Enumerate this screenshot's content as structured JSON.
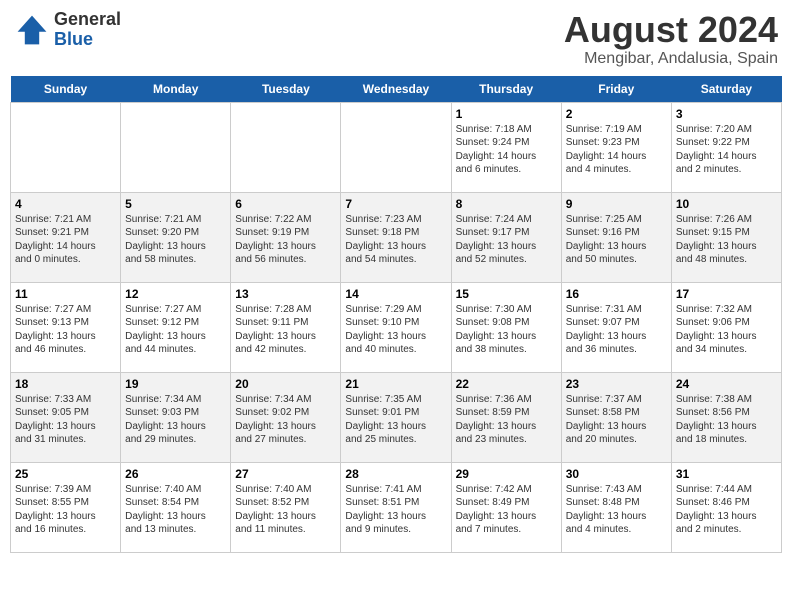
{
  "header": {
    "logo_line1": "General",
    "logo_line2": "Blue",
    "title": "August 2024",
    "subtitle": "Mengibar, Andalusia, Spain"
  },
  "columns": [
    "Sunday",
    "Monday",
    "Tuesday",
    "Wednesday",
    "Thursday",
    "Friday",
    "Saturday"
  ],
  "weeks": [
    {
      "days": [
        {
          "num": "",
          "info": ""
        },
        {
          "num": "",
          "info": ""
        },
        {
          "num": "",
          "info": ""
        },
        {
          "num": "",
          "info": ""
        },
        {
          "num": "1",
          "info": "Sunrise: 7:18 AM\nSunset: 9:24 PM\nDaylight: 14 hours\nand 6 minutes."
        },
        {
          "num": "2",
          "info": "Sunrise: 7:19 AM\nSunset: 9:23 PM\nDaylight: 14 hours\nand 4 minutes."
        },
        {
          "num": "3",
          "info": "Sunrise: 7:20 AM\nSunset: 9:22 PM\nDaylight: 14 hours\nand 2 minutes."
        }
      ]
    },
    {
      "days": [
        {
          "num": "4",
          "info": "Sunrise: 7:21 AM\nSunset: 9:21 PM\nDaylight: 14 hours\nand 0 minutes."
        },
        {
          "num": "5",
          "info": "Sunrise: 7:21 AM\nSunset: 9:20 PM\nDaylight: 13 hours\nand 58 minutes."
        },
        {
          "num": "6",
          "info": "Sunrise: 7:22 AM\nSunset: 9:19 PM\nDaylight: 13 hours\nand 56 minutes."
        },
        {
          "num": "7",
          "info": "Sunrise: 7:23 AM\nSunset: 9:18 PM\nDaylight: 13 hours\nand 54 minutes."
        },
        {
          "num": "8",
          "info": "Sunrise: 7:24 AM\nSunset: 9:17 PM\nDaylight: 13 hours\nand 52 minutes."
        },
        {
          "num": "9",
          "info": "Sunrise: 7:25 AM\nSunset: 9:16 PM\nDaylight: 13 hours\nand 50 minutes."
        },
        {
          "num": "10",
          "info": "Sunrise: 7:26 AM\nSunset: 9:15 PM\nDaylight: 13 hours\nand 48 minutes."
        }
      ]
    },
    {
      "days": [
        {
          "num": "11",
          "info": "Sunrise: 7:27 AM\nSunset: 9:13 PM\nDaylight: 13 hours\nand 46 minutes."
        },
        {
          "num": "12",
          "info": "Sunrise: 7:27 AM\nSunset: 9:12 PM\nDaylight: 13 hours\nand 44 minutes."
        },
        {
          "num": "13",
          "info": "Sunrise: 7:28 AM\nSunset: 9:11 PM\nDaylight: 13 hours\nand 42 minutes."
        },
        {
          "num": "14",
          "info": "Sunrise: 7:29 AM\nSunset: 9:10 PM\nDaylight: 13 hours\nand 40 minutes."
        },
        {
          "num": "15",
          "info": "Sunrise: 7:30 AM\nSunset: 9:08 PM\nDaylight: 13 hours\nand 38 minutes."
        },
        {
          "num": "16",
          "info": "Sunrise: 7:31 AM\nSunset: 9:07 PM\nDaylight: 13 hours\nand 36 minutes."
        },
        {
          "num": "17",
          "info": "Sunrise: 7:32 AM\nSunset: 9:06 PM\nDaylight: 13 hours\nand 34 minutes."
        }
      ]
    },
    {
      "days": [
        {
          "num": "18",
          "info": "Sunrise: 7:33 AM\nSunset: 9:05 PM\nDaylight: 13 hours\nand 31 minutes."
        },
        {
          "num": "19",
          "info": "Sunrise: 7:34 AM\nSunset: 9:03 PM\nDaylight: 13 hours\nand 29 minutes."
        },
        {
          "num": "20",
          "info": "Sunrise: 7:34 AM\nSunset: 9:02 PM\nDaylight: 13 hours\nand 27 minutes."
        },
        {
          "num": "21",
          "info": "Sunrise: 7:35 AM\nSunset: 9:01 PM\nDaylight: 13 hours\nand 25 minutes."
        },
        {
          "num": "22",
          "info": "Sunrise: 7:36 AM\nSunset: 8:59 PM\nDaylight: 13 hours\nand 23 minutes."
        },
        {
          "num": "23",
          "info": "Sunrise: 7:37 AM\nSunset: 8:58 PM\nDaylight: 13 hours\nand 20 minutes."
        },
        {
          "num": "24",
          "info": "Sunrise: 7:38 AM\nSunset: 8:56 PM\nDaylight: 13 hours\nand 18 minutes."
        }
      ]
    },
    {
      "days": [
        {
          "num": "25",
          "info": "Sunrise: 7:39 AM\nSunset: 8:55 PM\nDaylight: 13 hours\nand 16 minutes."
        },
        {
          "num": "26",
          "info": "Sunrise: 7:40 AM\nSunset: 8:54 PM\nDaylight: 13 hours\nand 13 minutes."
        },
        {
          "num": "27",
          "info": "Sunrise: 7:40 AM\nSunset: 8:52 PM\nDaylight: 13 hours\nand 11 minutes."
        },
        {
          "num": "28",
          "info": "Sunrise: 7:41 AM\nSunset: 8:51 PM\nDaylight: 13 hours\nand 9 minutes."
        },
        {
          "num": "29",
          "info": "Sunrise: 7:42 AM\nSunset: 8:49 PM\nDaylight: 13 hours\nand 7 minutes."
        },
        {
          "num": "30",
          "info": "Sunrise: 7:43 AM\nSunset: 8:48 PM\nDaylight: 13 hours\nand 4 minutes."
        },
        {
          "num": "31",
          "info": "Sunrise: 7:44 AM\nSunset: 8:46 PM\nDaylight: 13 hours\nand 2 minutes."
        }
      ]
    }
  ]
}
